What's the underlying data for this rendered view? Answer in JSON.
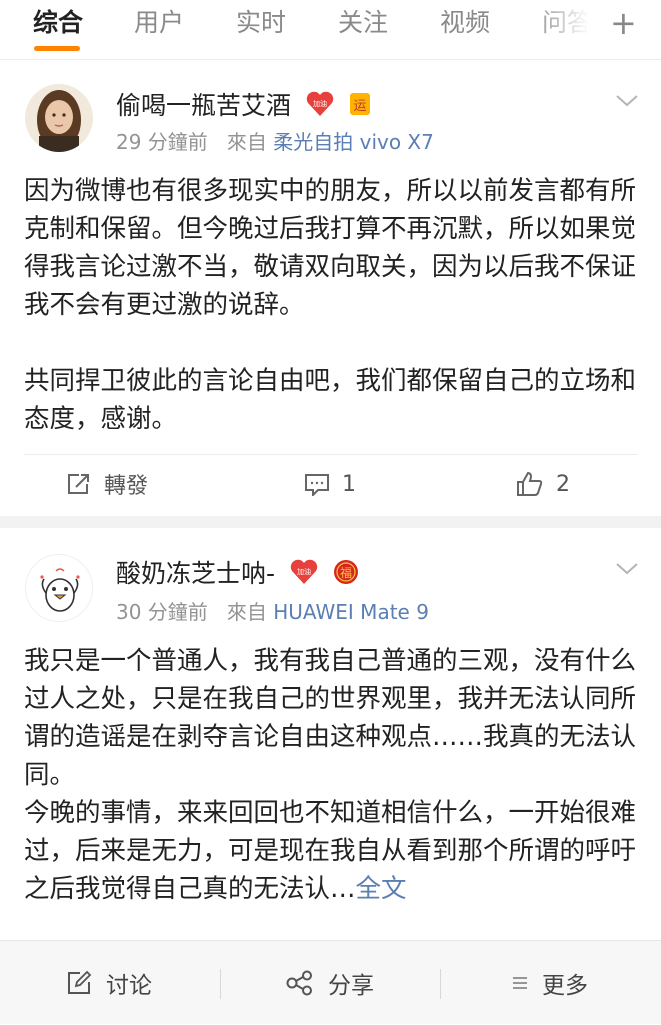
{
  "tabs": [
    "综合",
    "用户",
    "实时",
    "关注",
    "视频",
    "问答"
  ],
  "accent_color": "#ff8200",
  "link_color": "#5b7fb3",
  "posts": [
    {
      "username": "偷喝一瓶苦艾酒",
      "badges": [
        "加油",
        "运"
      ],
      "time": "29 分鐘前",
      "from_label": "來自",
      "source": "柔光自拍 vivo X7",
      "paragraphs": [
        "因为微博也有很多现实中的朋友，所以以前发言都有所克制和保留。但今晚过后我打算不再沉默，所以如果觉得我言论过激不当，敬请双向取关，因为以后我不保证我不会有更过激的说辞。",
        "共同捍卫彼此的言论自由吧，我们都保留自己的立场和态度，感谢。"
      ],
      "repost_label": "轉發",
      "comment_count": "1",
      "like_count": "2"
    },
    {
      "username": "酸奶冻芝士呐-",
      "badges": [
        "加油",
        "福"
      ],
      "time": "30 分鐘前",
      "from_label": "來自",
      "source": "HUAWEI Mate 9",
      "text": "我只是一个普通人，我有我自己普通的三观，没有什么过人之处，只是在我自己的世界观里，我并无法认同所谓的造谣是在剥夺言论自由这种观点……我真的无法认同。\n今晚的事情，来来回回也不知道相信什么，一开始很难过，后来是无力，可是现在我自从看到那个所谓的呼吁之后我觉得自己真的无法认…",
      "full_text_link": "全文"
    }
  ],
  "bottom_bar": {
    "comment_label": "讨论",
    "share_label": "分享",
    "more_label": "更多"
  }
}
